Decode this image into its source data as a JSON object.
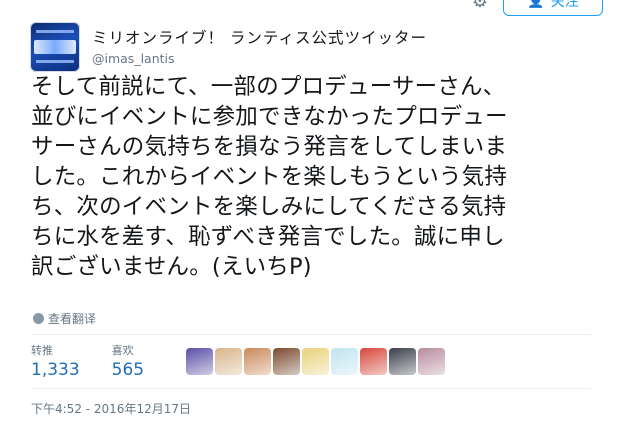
{
  "follow": {
    "label": "关注"
  },
  "account": {
    "display_name": "ミリオンライブ！ ランティス公式ツイッター",
    "screen_name": "@imas_lantis"
  },
  "tweet": {
    "lines": [
      "そして前説にて、一部のプロデューサーさん、",
      "並びにイベントに参加できなかったプロデュー",
      "サーさんの気持ちを損なう発言をしてしまいま",
      "した。これからイベントを楽しもうという気持",
      "ち、次のイベントを楽しみにしてくださる気持",
      "ちに水を差す、恥ずべき発言でした。誠に申し",
      "訳ございません。(えいちP)"
    ]
  },
  "translate_label": "查看翻译",
  "stats": {
    "retweets_label": "转推",
    "retweets_value": "1,333",
    "likes_label": "喜欢",
    "likes_value": "565"
  },
  "liker_avatars": [
    {
      "name": "liker-avatar-1",
      "color": "#5b4fa8"
    },
    {
      "name": "liker-avatar-2",
      "color": "#d9b48a"
    },
    {
      "name": "liker-avatar-3",
      "color": "#c98a5a"
    },
    {
      "name": "liker-avatar-4",
      "color": "#7a4a2e"
    },
    {
      "name": "liker-avatar-5",
      "color": "#e8d27a"
    },
    {
      "name": "liker-avatar-6",
      "color": "#bfe3ef"
    },
    {
      "name": "liker-avatar-7",
      "color": "#d7473a"
    },
    {
      "name": "liker-avatar-8",
      "color": "#3a3f4a"
    },
    {
      "name": "liker-avatar-9",
      "color": "#b98ca0"
    }
  ],
  "timestamp": "下午4:52 - 2016年12月17日"
}
